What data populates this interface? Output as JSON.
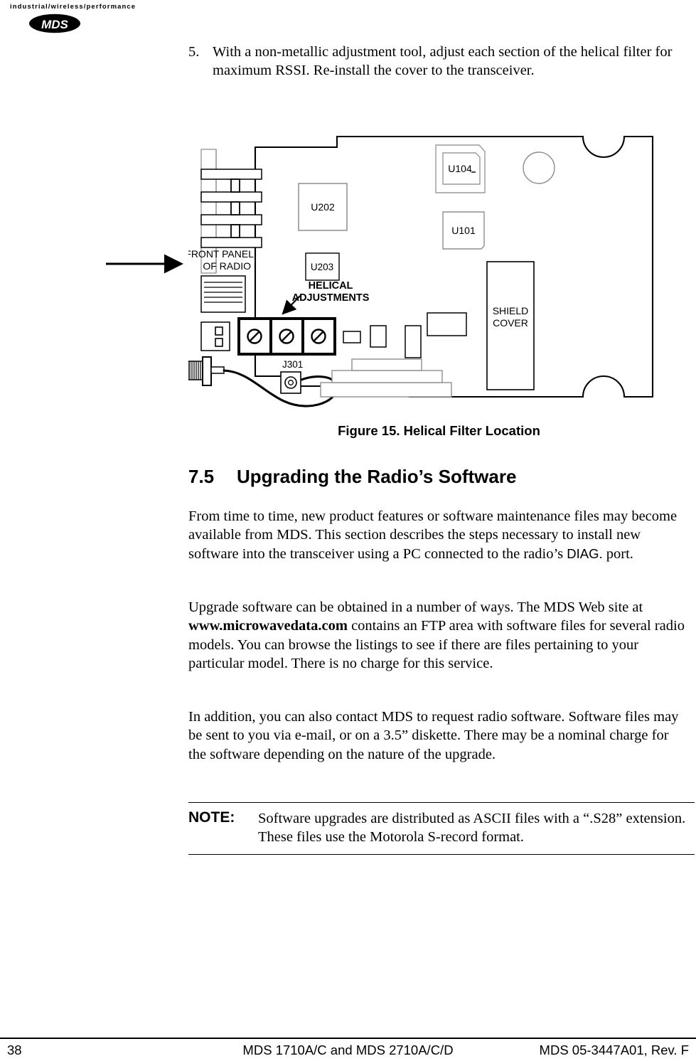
{
  "header": {
    "tagline": "industrial/wireless/performance",
    "logo_text": "MDS"
  },
  "step": {
    "number": "5.",
    "text": "With a non-metallic adjustment tool, adjust each section of the helical filter for maximum RSSI. Re-install the cover to the transceiver."
  },
  "figure": {
    "caption": "Figure 15. Helical Filter Location",
    "labels": {
      "front_panel": "FRONT PANEL",
      "front_panel2": "OF RADIO",
      "helical1": "HELICAL",
      "helical2": "ADJUSTMENTS",
      "shield1": "SHIELD",
      "shield2": "COVER",
      "u202": "U202",
      "u203": "U203",
      "u104": "U104",
      "u101": "U101",
      "j301": "J301"
    }
  },
  "section": {
    "number": "7.5",
    "title": "Upgrading the Radio’s Software"
  },
  "paragraphs": {
    "p1_a": "From time to time, new product features or software maintenance files may become available from MDS. This section describes the steps necessary to install new software into the transceiver using a PC connected to the radio’s ",
    "p1_diag": "DIAG.",
    "p1_b": " port.",
    "p2_a": "Upgrade software can be obtained in a number of ways. The MDS Web site at ",
    "p2_url": "www.microwavedata.com",
    "p2_b": " contains an FTP area with software files for several radio models. You can browse the listings to see if there are files pertaining to your particular model. There is no charge for this service.",
    "p3": "In addition, you can also contact MDS to request radio software. Software files may be sent to you via e-mail, or on a 3.5” diskette. There may be a nominal charge for the software depending on the nature of the upgrade."
  },
  "note": {
    "label": "NOTE:",
    "text": "Software upgrades are distributed as ASCII files with a “.S28” extension. These files use the Motorola S-record format."
  },
  "footer": {
    "page": "38",
    "center": "MDS 1710A/C and MDS 2710A/C/D",
    "right": "MDS 05-3447A01, Rev. F"
  }
}
